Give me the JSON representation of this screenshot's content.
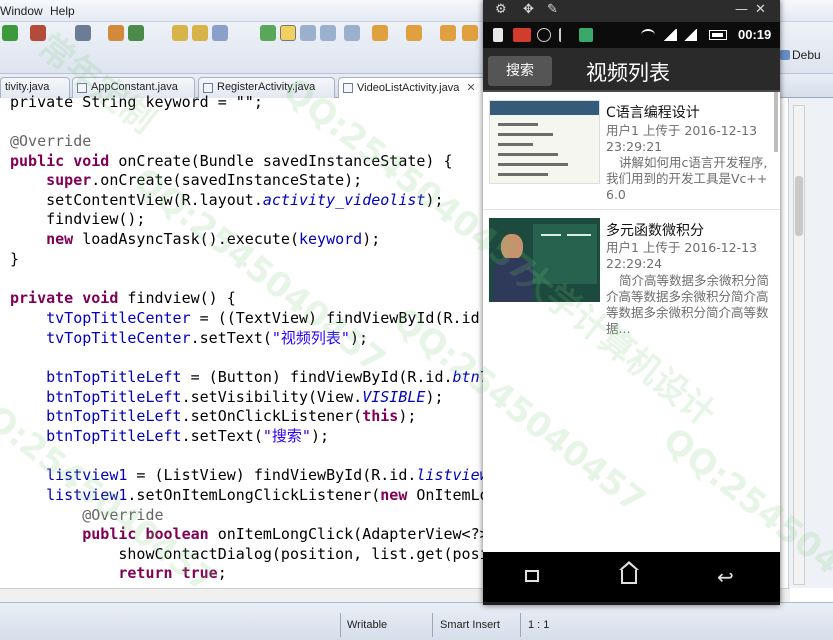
{
  "menubar": {
    "items": [
      "Window",
      "Help"
    ]
  },
  "tabs": [
    {
      "label": "tivity.java",
      "active": false
    },
    {
      "label": "AppConstant.java",
      "active": false
    },
    {
      "label": "RegisterActivity.java",
      "active": false
    },
    {
      "label": "VideoListActivity.java",
      "active": true,
      "close": "✕"
    }
  ],
  "side_panel": {
    "label": "Debu"
  },
  "code": {
    "l1": "private String keyword = \"\";",
    "l3": "@Override",
    "l4a": "public void",
    "l4b": " onCreate(Bundle savedInstanceState) {",
    "l5a": "    super",
    "l5b": ".onCreate(savedInstanceState);",
    "l6a": "    setContentView(R.layout.",
    "l6b": "activity_videolist",
    "l6c": ");",
    "l7": "    findview();",
    "l8a": "    new",
    "l8b": " loadAsyncTask().execute(",
    "l8c": "keyword",
    "l8d": ");",
    "l9": "}",
    "l11a": "private void",
    "l11b": " findview() {",
    "l12a": "    tvTopTitleCenter",
    "l12b": " = ((TextView) findViewById(R.id.",
    "l13a": "    tvTopTitleCenter",
    "l13b": ".setText(",
    "l13c": "\"视频列表\"",
    "l13d": ");",
    "l15a": "    btnTopTitleLeft",
    "l15b": " = (Button) findViewById(R.id.",
    "l15c": "btnT",
    "l16a": "    btnTopTitleLeft",
    "l16b": ".setVisibility(View.",
    "l16c": "VISIBLE",
    "l16d": ");",
    "l17a": "    btnTopTitleLeft",
    "l17b": ".setOnClickListener(",
    "l17c": "this",
    "l17d": ");",
    "l18a": "    btnTopTitleLeft",
    "l18b": ".setText(",
    "l18c": "\"搜索\"",
    "l18d": ");",
    "l20a": "    listview1",
    "l20b": " = (ListView) findViewById(R.id.",
    "l20c": "listview",
    "l21a": "    listview1",
    "l21b": ".setOnItemLongClickListener(",
    "l21c": "new",
    "l21d": " OnItemLo",
    "l22": "        @Override",
    "l23a": "        public boolean",
    "l23b": " onItemLongClick(AdapterView<?>",
    "l24": "            showContactDialog(position, list.get(posi",
    "l25a": "            return true",
    "l25b": ";"
  },
  "statusbar": {
    "mode": "Writable",
    "insert": "Smart Insert",
    "position": "1 : 1"
  },
  "phone": {
    "clock": "00:19",
    "search_label": "搜索",
    "title": "视频列表",
    "items": [
      {
        "title": "C语言编程设计",
        "meta": "用户1 上传于 2016-12-13 23:29:21",
        "desc": "讲解如何用c语言开发程序,我们用到的开发工具是Vc++6.0"
      },
      {
        "title": "多元函数微积分",
        "meta": "用户1 上传于 2016-12-13 22:29:24",
        "desc": "简介高等数据多余微积分简介高等数据多余微积分简介高等数据多余微积分简介高等数据..."
      }
    ]
  },
  "watermark": {
    "text1": "QQ:2545040457",
    "text2": "大学计算机设计",
    "text3": "常年定制"
  }
}
